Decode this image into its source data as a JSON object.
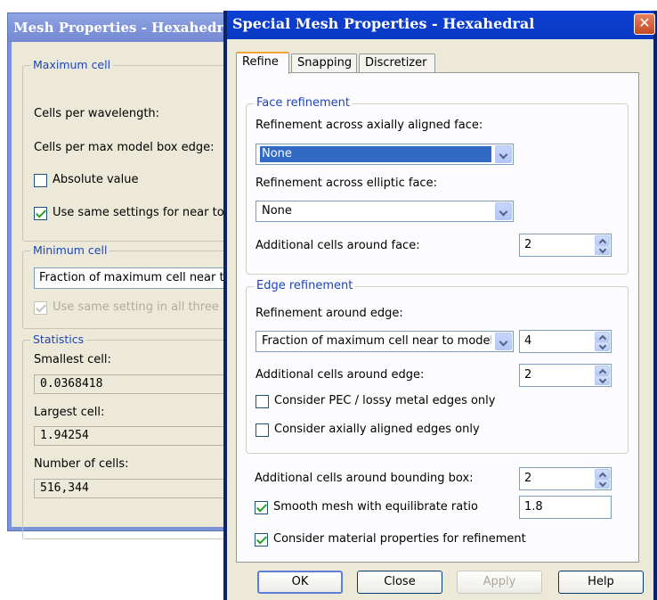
{
  "bg_window": {
    "title": "Mesh Properties - Hexahedral",
    "max_cell": {
      "legend": "Maximum cell",
      "cells_per_wavelength": "Cells per wavelength:",
      "cells_per_max_edge": "Cells per max model box edge:",
      "absolute_value": "Absolute value",
      "use_same_settings": "Use same settings for near to"
    },
    "min_cell": {
      "legend": "Minimum cell",
      "dropdown_value": "Fraction of maximum cell near to",
      "use_same_setting": "Use same setting in all three"
    },
    "statistics": {
      "legend": "Statistics",
      "smallest_label": "Smallest cell:",
      "smallest_value": "0.0368418",
      "largest_label": "Largest cell:",
      "largest_value": "1.94254",
      "count_label": "Number of cells:",
      "count_value": "516,344"
    }
  },
  "dialog": {
    "title": "Special Mesh Properties - Hexahedral",
    "close_glyph": "✕",
    "tabs": [
      {
        "label": "Refine",
        "active": true
      },
      {
        "label": "Snapping",
        "active": false
      },
      {
        "label": "Discretizer",
        "active": false
      }
    ],
    "face": {
      "legend": "Face refinement",
      "axially_label": "Refinement across axially aligned face:",
      "axially_value": "None",
      "elliptic_label": "Refinement across elliptic face:",
      "elliptic_value": "None",
      "additional_label": "Additional cells around face:",
      "additional_value": "2"
    },
    "edge": {
      "legend": "Edge refinement",
      "around_label": "Refinement around edge:",
      "around_value": "Fraction of maximum cell near to model",
      "around_number": "4",
      "additional_label": "Additional cells around edge:",
      "additional_value": "2",
      "pec_only": "Consider PEC / lossy metal edges only",
      "axially_only": "Consider axially aligned edges only"
    },
    "bbox_label": "Additional cells around bounding box:",
    "bbox_value": "2",
    "smooth_label": "Smooth mesh with equilibrate ratio",
    "smooth_value": "1.8",
    "material_label": "Consider material properties for refinement",
    "buttons": {
      "ok": "OK",
      "close": "Close",
      "apply": "Apply",
      "help": "Help"
    }
  }
}
